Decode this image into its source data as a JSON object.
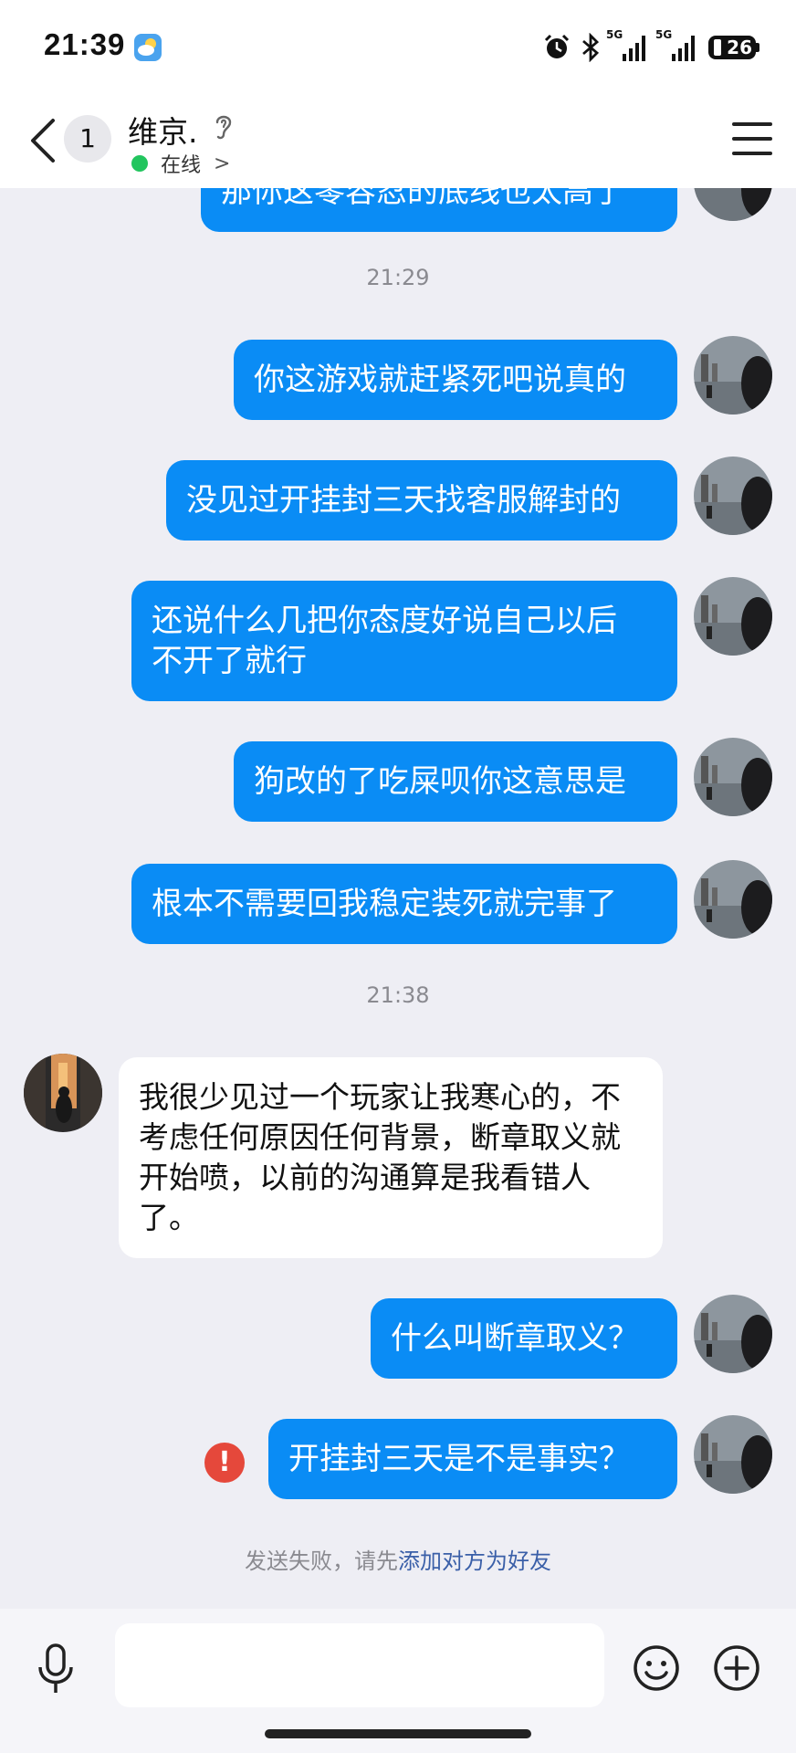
{
  "status_bar": {
    "time": "21:39",
    "weather_icon": "weather-cloud-sun-icon",
    "network_labels": [
      "5G",
      "5G"
    ],
    "battery": "26"
  },
  "header": {
    "unread_count": "1",
    "contact_name": "维京.",
    "online_status": "在线",
    "chevron": ">"
  },
  "messages": {
    "top_partial": "那你这零容忍的底线也太高了",
    "time_1": "21:29",
    "out_1": "你这游戏就赶紧死吧说真的",
    "out_2": "没见过开挂封三天找客服解封的",
    "out_3_line1": "还说什么几把你态度好说自己以后",
    "out_3_line2": "不开了就行",
    "out_4": "狗改的了吃屎呗你这意思是",
    "out_5": "根本不需要回我稳定装死就完事了",
    "time_2": "21:38",
    "in_1": "我很少见过一个玩家让我寒心的，不考虑任何原因任何背景，断章取义就开始喷，以前的沟通算是我看错人了。",
    "out_6": "什么叫断章取义？",
    "out_7": "开挂封三天是不是事实？",
    "error_mark": "!",
    "fail_prefix": "发送失败，请先",
    "fail_link": "添加对方为好友"
  },
  "input_bar": {
    "placeholder": ""
  },
  "colors": {
    "bubble_out": "#0a8cf5",
    "error": "#e5483b",
    "online": "#22c55e",
    "link": "#3a5fa8"
  }
}
